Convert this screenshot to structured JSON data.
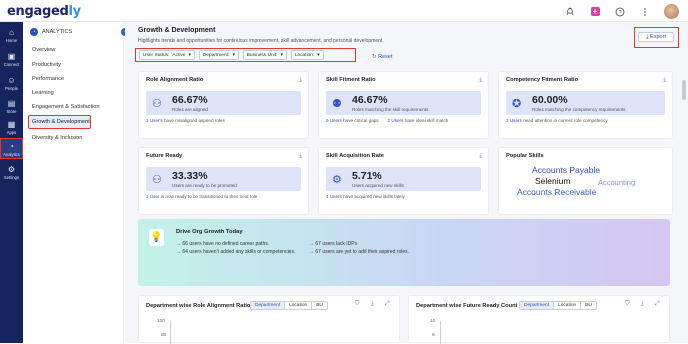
{
  "app": {
    "logo_main": "engaged",
    "logo_accent": "ly"
  },
  "nav": {
    "items": [
      {
        "label": "Home",
        "icon": "home-icon"
      },
      {
        "label": "Connect",
        "icon": "connect-icon"
      },
      {
        "label": "People",
        "icon": "people-icon"
      },
      {
        "label": "Store",
        "icon": "store-icon"
      },
      {
        "label": "Apps",
        "icon": "apps-icon"
      },
      {
        "label": "Analytics",
        "icon": "analytics-icon"
      },
      {
        "label": "Settings",
        "icon": "settings-icon"
      }
    ]
  },
  "subnav": {
    "header": "ANALYTICS",
    "items": [
      "Overview",
      "Productivity",
      "Performance",
      "Learning",
      "Engagement & Satisfaction",
      "Growth & Development",
      "Diversity & Inclusion"
    ]
  },
  "page": {
    "title": "Growth & Development",
    "subtitle": "Highlights trends and opportunities for continuous improvement, skill advancement, and personal development.",
    "export": "Export",
    "reset": "Reset"
  },
  "filters": {
    "user_status_label": "User Status:",
    "user_status_value": "Active",
    "department": "Department:",
    "business_unit": "Business Unit:",
    "location": "Location:"
  },
  "cards": {
    "role_alignment": {
      "title": "Role Alignment Ratio",
      "value": "66.67%",
      "caption": "Roles are aligned",
      "foot_link": "1 User's",
      "foot_text": " have misaligned aspired roles"
    },
    "skill_fitment": {
      "title": "Skill Fitment Ratio",
      "value": "46.67%",
      "caption": "Roles matching the skill requirements",
      "foot_link1": "9 Users",
      "foot_text1": " have critical gaps",
      "foot_link2": "2 Users",
      "foot_text2": " have ideal skill match"
    },
    "competency_fitment": {
      "title": "Competency Fitment Ratio",
      "value": "60.00%",
      "caption": "Roles matching the competency requirements",
      "foot_link": "2 Users",
      "foot_text": " need attention in current role competency"
    },
    "future_ready": {
      "title": "Future Ready",
      "value": "33.33%",
      "caption": "Users are ready to be promoted",
      "foot_link": "1 User",
      "foot_text": " is now ready to be transitioned to their next role"
    },
    "skill_acquisition": {
      "title": "Skill Acquisition Rate",
      "value": "5.71%",
      "caption": "Users acquired new skills",
      "foot_link": "4 Users",
      "foot_text": " have acquired new skills lately"
    },
    "popular_skills": {
      "title": "Popular Skills",
      "skills": [
        "Accounts Payable",
        "Selenium",
        "Accounting",
        "Accounts Receivable"
      ]
    }
  },
  "banner": {
    "title": "Drive Org Growth Today",
    "line1_count": "66",
    "line1_text": " users have no defined career paths.",
    "line2_count": "64",
    "line2_text": " users haven't added any skills or competencies.",
    "line3_count": "67",
    "line3_text": " users lack IDPs",
    "line4_count": "67",
    "line4_text": " users are yet to add their aspired roles."
  },
  "charts": {
    "left": {
      "title": "Department wise Role Alignment Ratio",
      "tabs": [
        "Department",
        "Location",
        "BU"
      ]
    },
    "right": {
      "title": "Department wise Future Ready Count",
      "tabs": [
        "Department",
        "Location",
        "BU"
      ]
    }
  },
  "chart_data": [
    {
      "type": "bar",
      "title": "Department wise Role Alignment Ratio",
      "tick_labels": [
        "100",
        "80"
      ],
      "categories": [],
      "values": []
    },
    {
      "type": "bar",
      "title": "Department wise Future Ready Count",
      "tick_labels": [
        "10",
        "8"
      ],
      "categories": [],
      "values": []
    }
  ],
  "colors": {
    "nav_bg": "#15245c",
    "accent": "#2d4fb0",
    "kpi_bg": "#dee3f8",
    "highlight": "#e03a2f"
  }
}
